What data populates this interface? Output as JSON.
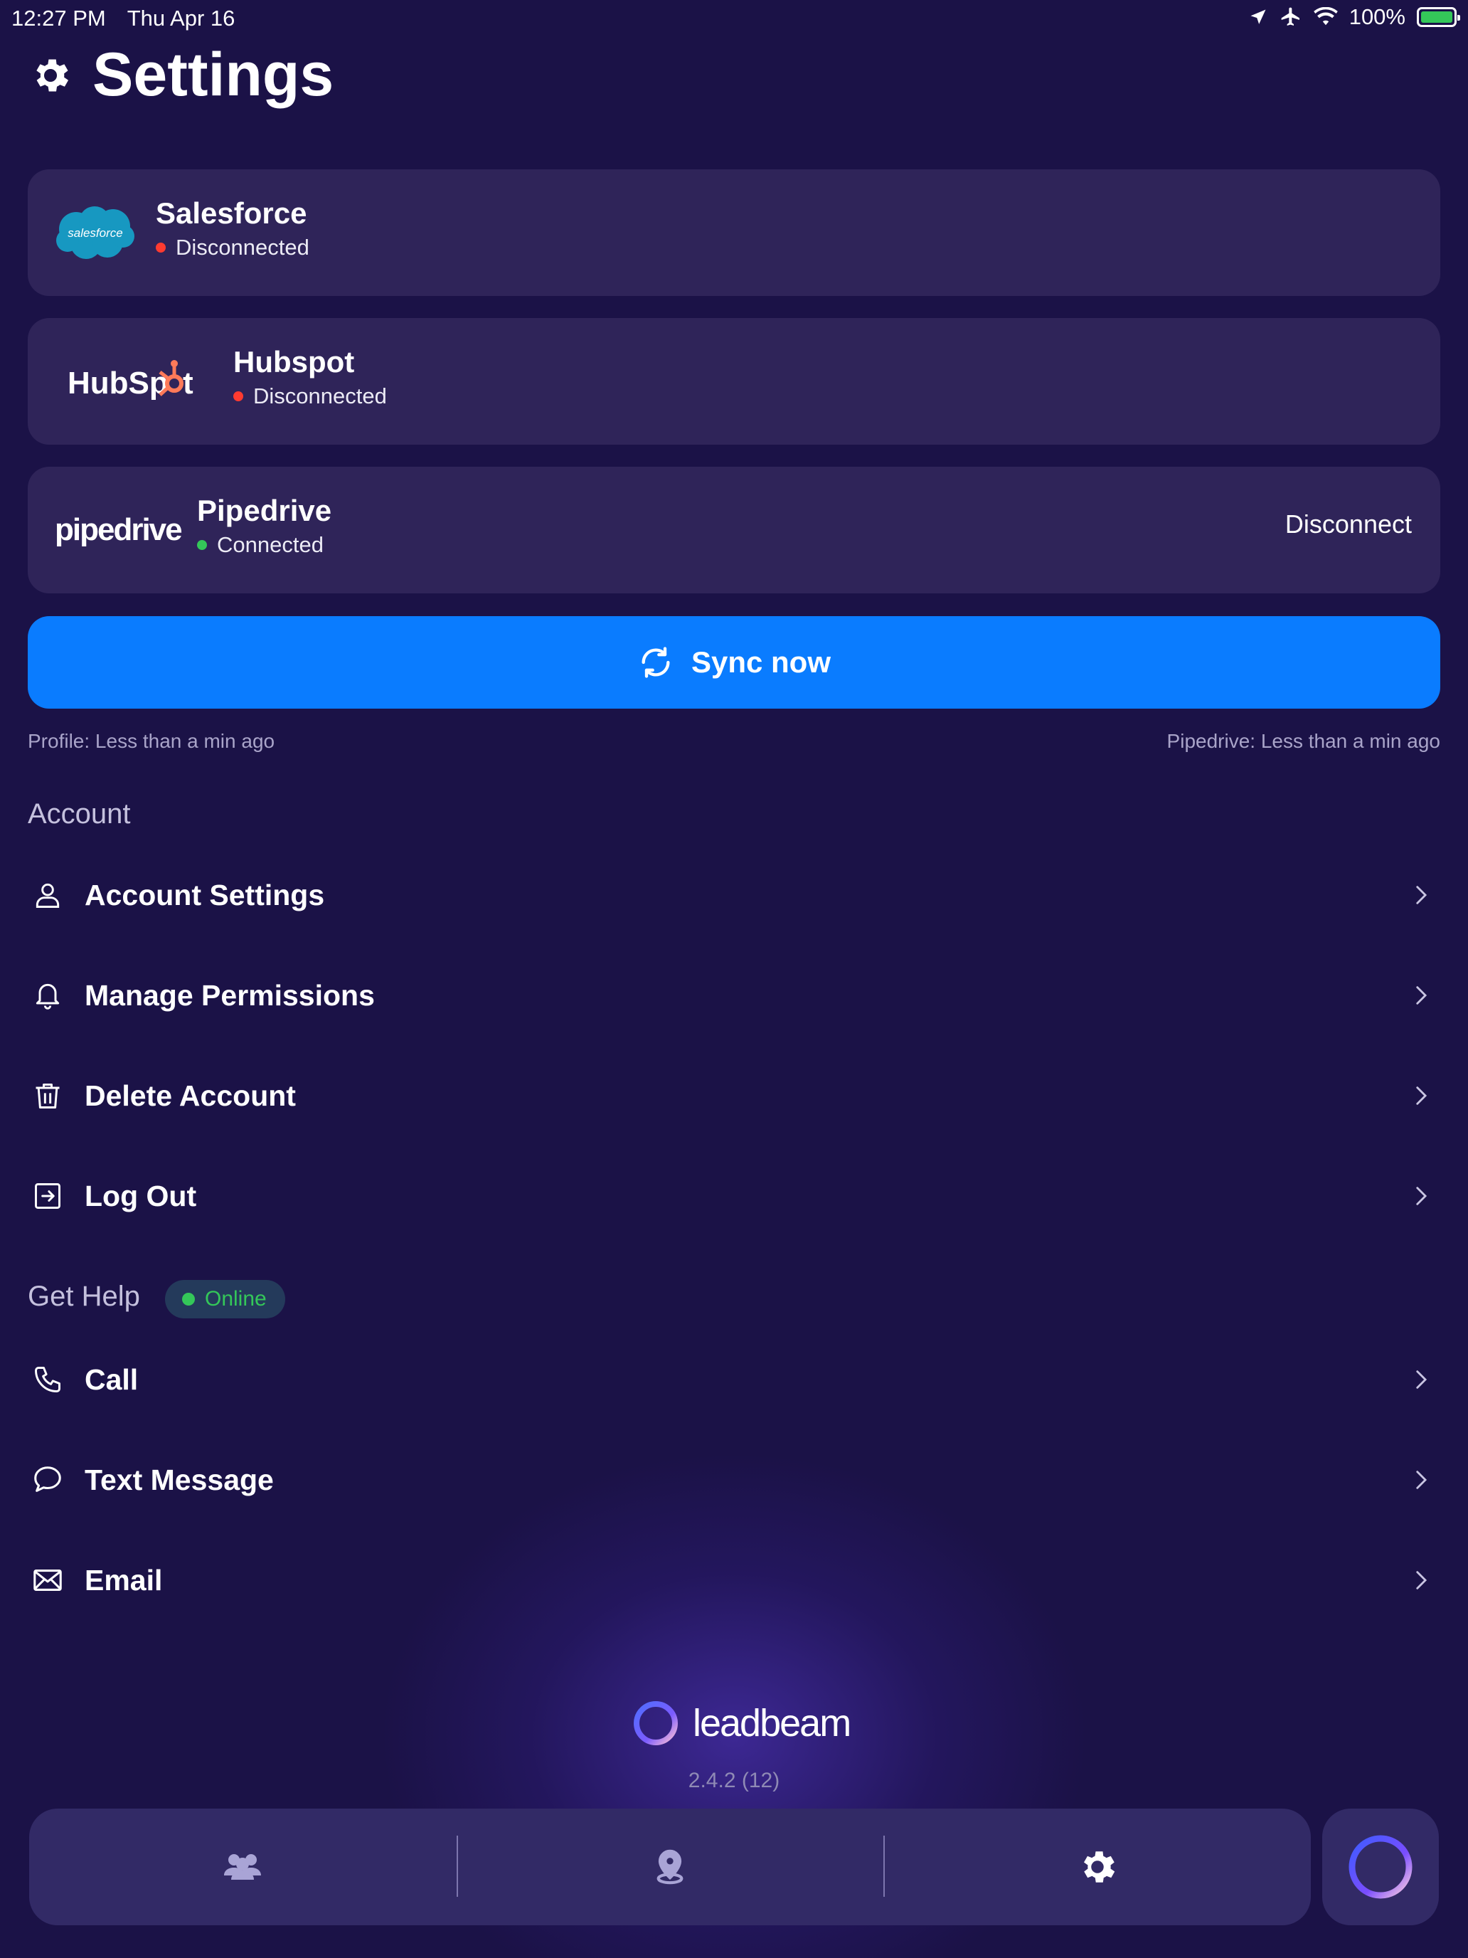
{
  "status_bar": {
    "time": "12:27 PM",
    "date": "Thu Apr 16",
    "battery": "100%"
  },
  "page": {
    "title": "Settings"
  },
  "integrations": [
    {
      "name": "Salesforce",
      "status": "Disconnected",
      "logo_text": "salesforce",
      "status_color": "#ff3b30"
    },
    {
      "name": "Hubspot",
      "status": "Disconnected",
      "logo_text": "HubSpot",
      "status_color": "#ff3b30"
    },
    {
      "name": "Pipedrive",
      "status": "Connected",
      "logo_text": "pipedrive",
      "status_color": "#34c759",
      "action": "Disconnect"
    }
  ],
  "sync": {
    "button_label": "Sync now",
    "profile_status": "Profile: Less than a min ago",
    "pipedrive_status": "Pipedrive: Less than a min ago"
  },
  "account": {
    "title": "Account",
    "items": [
      {
        "label": "Account Settings",
        "icon": "person-icon"
      },
      {
        "label": "Manage Permissions",
        "icon": "bell-icon"
      },
      {
        "label": "Delete Account",
        "icon": "trash-icon"
      },
      {
        "label": "Log Out",
        "icon": "logout-icon"
      }
    ]
  },
  "help": {
    "title": "Get Help",
    "badge": "Online",
    "items": [
      {
        "label": "Call",
        "icon": "phone-icon"
      },
      {
        "label": "Text Message",
        "icon": "chat-bubble-icon"
      },
      {
        "label": "Email",
        "icon": "envelope-icon"
      }
    ]
  },
  "footer": {
    "brand": "leadbeam",
    "version": "2.4.2 (12)"
  },
  "tabbar": {
    "tabs": [
      {
        "icon": "people-icon"
      },
      {
        "icon": "map-pin-icon"
      },
      {
        "icon": "gear-icon",
        "active": true
      }
    ]
  },
  "colors": {
    "background": "#1b1247",
    "card": "#2f2459",
    "accent": "#0a7cff",
    "connected": "#34c759",
    "disconnected": "#ff3b30"
  }
}
